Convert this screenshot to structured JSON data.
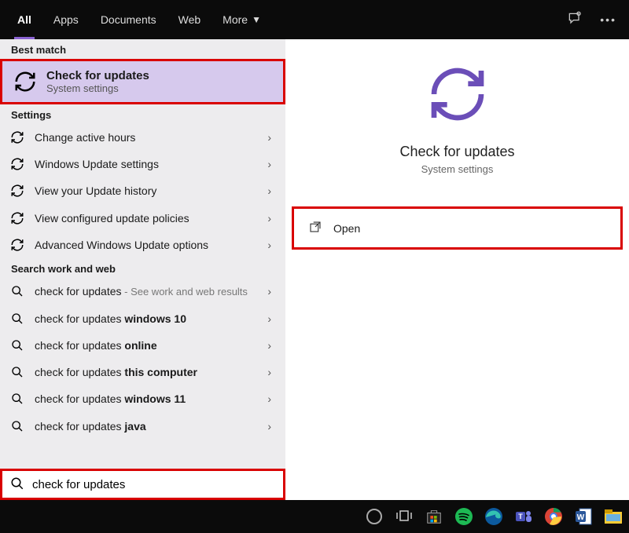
{
  "topbar": {
    "tabs": [
      "All",
      "Apps",
      "Documents",
      "Web",
      "More"
    ],
    "active_index": 0
  },
  "left": {
    "best_match_header": "Best match",
    "best_match": {
      "title": "Check for updates",
      "subtitle": "System settings"
    },
    "settings_header": "Settings",
    "settings_items": [
      {
        "label": "Change active hours"
      },
      {
        "label": "Windows Update settings"
      },
      {
        "label": "View your Update history"
      },
      {
        "label": "View configured update policies"
      },
      {
        "label": "Advanced Windows Update options"
      }
    ],
    "search_header": "Search work and web",
    "search_items": [
      {
        "prefix": "check for updates",
        "suffix": " - See work and web results"
      },
      {
        "prefix": "check for updates ",
        "bold": "windows 10"
      },
      {
        "prefix": "check for updates ",
        "bold": "online"
      },
      {
        "prefix": "check for updates ",
        "bold": "this computer"
      },
      {
        "prefix": "check for updates ",
        "bold": "windows 11"
      },
      {
        "prefix": "check for updates ",
        "bold": "java"
      }
    ]
  },
  "right": {
    "title": "Check for updates",
    "subtitle": "System settings",
    "open_label": "Open"
  },
  "search": {
    "value": "check for updates"
  }
}
